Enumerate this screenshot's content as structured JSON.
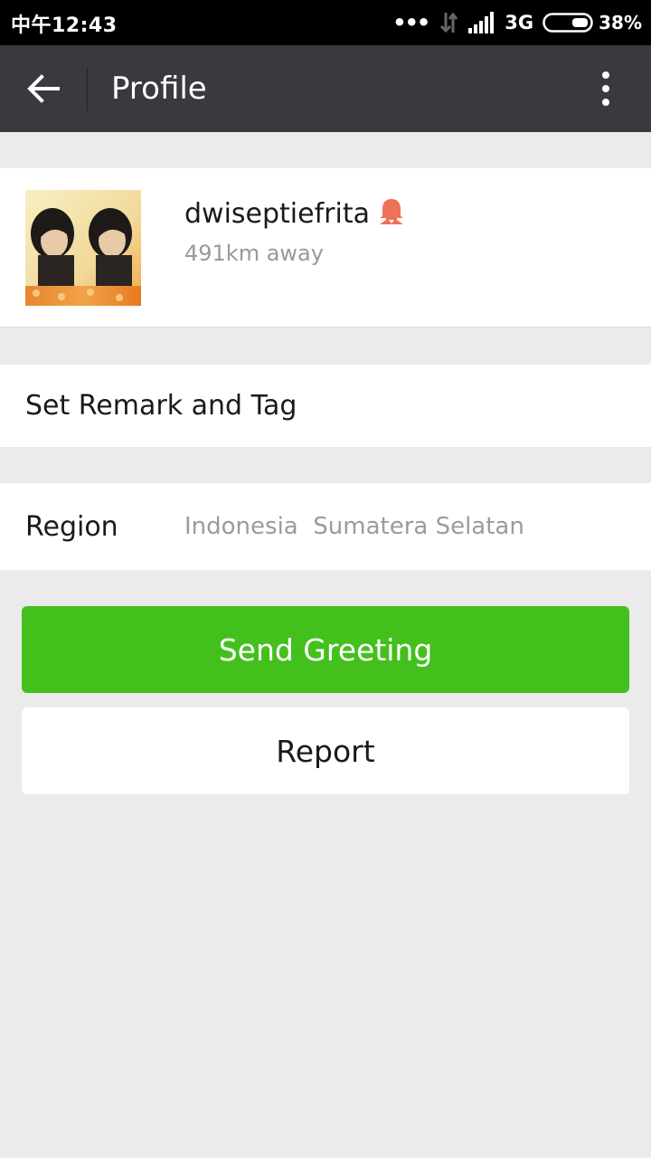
{
  "status_bar": {
    "time": "中午12:43",
    "dots": "•••",
    "network": "3G",
    "battery": "38%"
  },
  "toolbar": {
    "title": "Profile",
    "back_icon": "arrow-left-icon",
    "more_icon": "more-vertical-icon"
  },
  "profile": {
    "username": "dwiseptiefrita",
    "distance": "491km away",
    "gender_icon": "female-icon",
    "gender_color": "#f0705a"
  },
  "remark": {
    "label": "Set Remark and Tag"
  },
  "region": {
    "label": "Region",
    "value": "Indonesia  Sumatera Selatan"
  },
  "buttons": {
    "greet_label": "Send Greeting",
    "report_label": "Report"
  },
  "colors": {
    "toolbar": "#393a3f",
    "accent_green": "#44c01d",
    "background": "#ebebeb"
  }
}
